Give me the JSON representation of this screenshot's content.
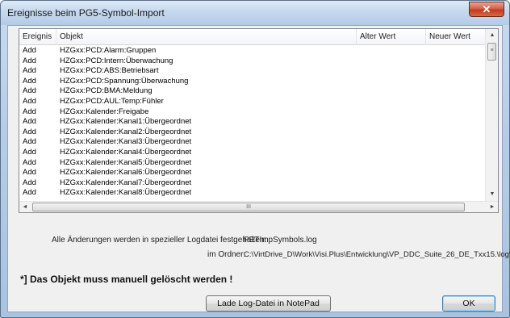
{
  "window": {
    "title": "Ereignisse beim PG5-Symbol-Import",
    "close_label": "✕"
  },
  "table": {
    "columns": [
      "Ereignis",
      "Objekt",
      "Alter Wert",
      "Neuer Wert"
    ],
    "rows": [
      {
        "ereignis": "Add",
        "objekt": "HZGxx:PCD:Alarm:Gruppen",
        "alter_wert": "",
        "neuer_wert": ""
      },
      {
        "ereignis": "Add",
        "objekt": "HZGxx:PCD:Intern:Überwachung",
        "alter_wert": "",
        "neuer_wert": ""
      },
      {
        "ereignis": "Add",
        "objekt": "HZGxx:PCD:ABS:Betriebsart",
        "alter_wert": "",
        "neuer_wert": ""
      },
      {
        "ereignis": "Add",
        "objekt": "HZGxx:PCD:Spannung:Überwachung",
        "alter_wert": "",
        "neuer_wert": ""
      },
      {
        "ereignis": "Add",
        "objekt": "HZGxx:PCD:BMA:Meldung",
        "alter_wert": "",
        "neuer_wert": ""
      },
      {
        "ereignis": "Add",
        "objekt": "HZGxx:PCD:AUL:Temp:Fühler",
        "alter_wert": "",
        "neuer_wert": ""
      },
      {
        "ereignis": "Add",
        "objekt": "HZGxx:Kalender:Freigabe",
        "alter_wert": "",
        "neuer_wert": ""
      },
      {
        "ereignis": "Add",
        "objekt": "HZGxx:Kalender:Kanal1:Übergeordnet",
        "alter_wert": "",
        "neuer_wert": ""
      },
      {
        "ereignis": "Add",
        "objekt": "HZGxx:Kalender:Kanal2:Übergeordnet",
        "alter_wert": "",
        "neuer_wert": ""
      },
      {
        "ereignis": "Add",
        "objekt": "HZGxx:Kalender:Kanal3:Übergeordnet",
        "alter_wert": "",
        "neuer_wert": ""
      },
      {
        "ereignis": "Add",
        "objekt": "HZGxx:Kalender:Kanal4:Übergeordnet",
        "alter_wert": "",
        "neuer_wert": ""
      },
      {
        "ereignis": "Add",
        "objekt": "HZGxx:Kalender:Kanal5:Übergeordnet",
        "alter_wert": "",
        "neuer_wert": ""
      },
      {
        "ereignis": "Add",
        "objekt": "HZGxx:Kalender:Kanal6:Übergeordnet",
        "alter_wert": "",
        "neuer_wert": ""
      },
      {
        "ereignis": "Add",
        "objekt": "HZGxx:Kalender:Kanal7:Übergeordnet",
        "alter_wert": "",
        "neuer_wert": ""
      },
      {
        "ereignis": "Add",
        "objekt": "HZGxx:Kalender:Kanal8:Übergeordnet",
        "alter_wert": "",
        "neuer_wert": ""
      }
    ]
  },
  "scrollbars": {
    "up_arrow": "▲",
    "down_arrow": "▼",
    "left_arrow": "◄",
    "right_arrow": "►",
    "vthumb_grip": "≡",
    "hthumb_grip": "III"
  },
  "info": {
    "log_label": "Alle Änderungen werden in spezieller Logdatei festgehalten:",
    "log_value": "PETImpSymbols.log",
    "folder_label": "im Ordner:",
    "folder_value": "C:\\VirtDrive_D\\Work\\Visi.Plus\\Entwicklung\\VP_DDC_Suite_26_DE_Txx15.\\log\\"
  },
  "warning": "*] Das Objekt muss manuell gelöscht werden !",
  "buttons": {
    "notepad": "Lade Log-Datei in NotePad",
    "ok": "OK"
  }
}
